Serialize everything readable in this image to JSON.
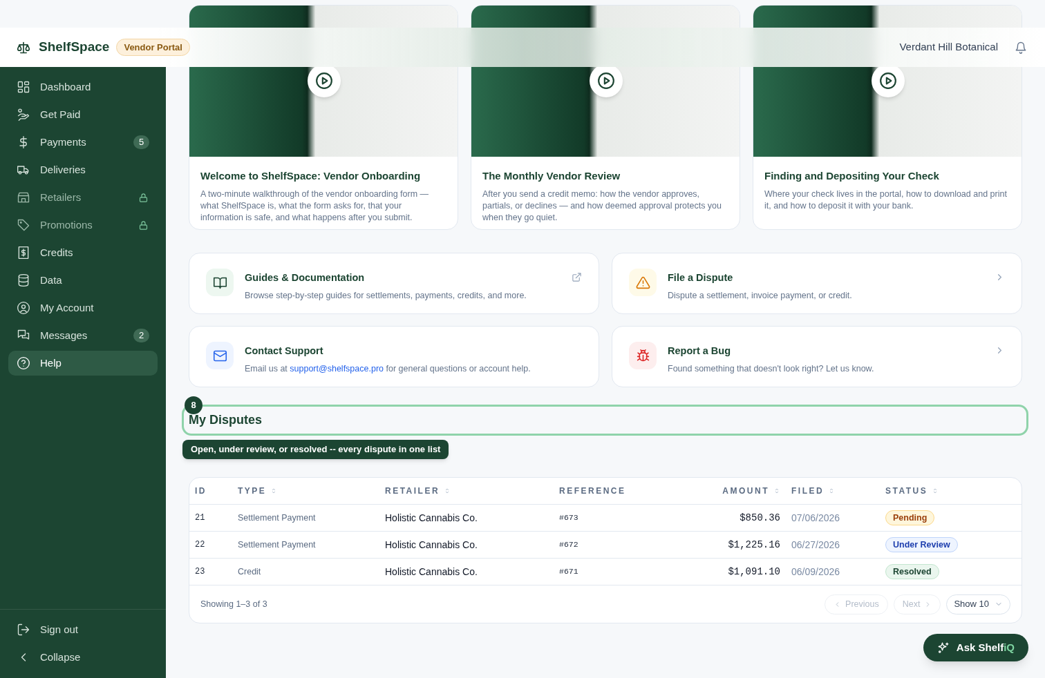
{
  "header": {
    "brand": "ShelfSpace",
    "badge": "Vendor Portal",
    "account": "Verdant Hill Botanical"
  },
  "sidebar": {
    "items": [
      {
        "label": "Dashboard",
        "locked": false,
        "selected": false
      },
      {
        "label": "Get Paid",
        "locked": false,
        "selected": false
      },
      {
        "label": "Payments",
        "badge": "5",
        "locked": false,
        "selected": false
      },
      {
        "label": "Deliveries",
        "locked": false,
        "selected": false
      },
      {
        "label": "Retailers",
        "locked": true,
        "selected": false
      },
      {
        "label": "Promotions",
        "locked": true,
        "selected": false
      },
      {
        "label": "Credits",
        "locked": false,
        "selected": false
      },
      {
        "label": "Data",
        "locked": false,
        "selected": false
      },
      {
        "label": "My Account",
        "locked": false,
        "selected": false
      },
      {
        "label": "Messages",
        "badge": "2",
        "locked": false,
        "selected": false
      },
      {
        "label": "Help",
        "locked": false,
        "selected": true
      }
    ],
    "footer": [
      {
        "label": "Sign out"
      },
      {
        "label": "Collapse"
      }
    ]
  },
  "videos": [
    {
      "title": "Welcome to ShelfSpace: Vendor Onboarding",
      "description": "A two-minute walkthrough of the vendor onboarding form — what ShelfSpace is, what the form asks for, that your information is safe, and what happens after you submit."
    },
    {
      "title": "The Monthly Vendor Review",
      "description": "After you send a credit memo: how the vendor approves, partials, or declines — and how deemed approval protects you when they go quiet."
    },
    {
      "title": "Finding and Depositing Your Check",
      "description": "Where your check lives in the portal, how to download and print it, and how to deposit it with your bank."
    }
  ],
  "links": [
    {
      "kind": "guides",
      "title": "Guides & Documentation",
      "description": "Browse step-by-step guides for settlements, payments, credits, and more."
    },
    {
      "kind": "dispute",
      "title": "File a Dispute",
      "description": "Dispute a settlement, invoice payment, or credit."
    },
    {
      "kind": "support",
      "title": "Contact Support",
      "description": "Email us at ",
      "link": "support@shelfspace.pro",
      "description_after": " for general questions or account help."
    },
    {
      "kind": "bug",
      "title": "Report a Bug",
      "description": "Found something that doesn't look right? Let us know."
    }
  ],
  "tour": {
    "step": "8",
    "tooltip": "Open, under review, or resolved -- every dispute in one list"
  },
  "disputes": {
    "title": "My Disputes",
    "columns": [
      {
        "label": "ID",
        "sortable": false
      },
      {
        "label": "TYPE",
        "sortable": true
      },
      {
        "label": "RETAILER",
        "sortable": true
      },
      {
        "label": "REFERENCE",
        "sortable": false
      },
      {
        "label": "AMOUNT",
        "sortable": true
      },
      {
        "label": "FILED",
        "sortable": true
      },
      {
        "label": "STATUS",
        "sortable": true
      }
    ],
    "rows": [
      {
        "id": "21",
        "type": "Settlement Payment",
        "retailer": "Holistic Cannabis Co.",
        "reference": "#673",
        "amount": "$850.36",
        "filed": "07/06/2026",
        "status": "Pending",
        "kind": "pending"
      },
      {
        "id": "22",
        "type": "Settlement Payment",
        "retailer": "Holistic Cannabis Co.",
        "reference": "#672",
        "amount": "$1,225.16",
        "filed": "06/27/2026",
        "status": "Under Review",
        "kind": "review"
      },
      {
        "id": "23",
        "type": "Credit",
        "retailer": "Holistic Cannabis Co.",
        "reference": "#671",
        "amount": "$1,091.10",
        "filed": "06/09/2026",
        "status": "Resolved",
        "kind": "resolved"
      }
    ],
    "showing": "Showing 1–3 of 3",
    "previous": {
      "label": "Previous",
      "disabled": true
    },
    "next": {
      "label": "Next",
      "disabled": true
    },
    "page_size": "Show 10"
  },
  "assistant": {
    "label": "Ask Shelf",
    "accent": "iQ"
  }
}
